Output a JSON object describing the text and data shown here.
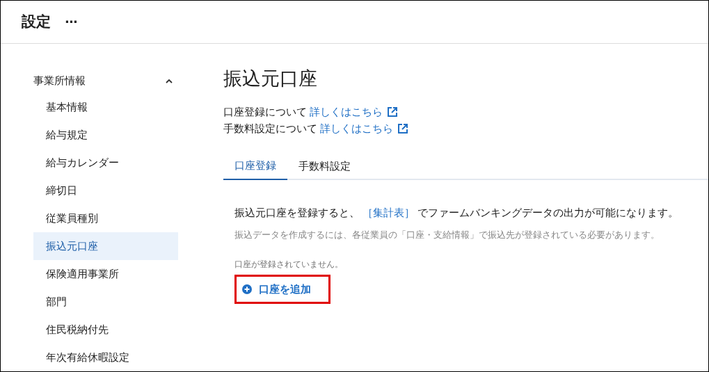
{
  "header": {
    "title": "設定",
    "more": "···"
  },
  "sidebar": {
    "group": {
      "label": "事業所情報",
      "expanded": true
    },
    "items": [
      {
        "label": "基本情報",
        "selected": false
      },
      {
        "label": "給与規定",
        "selected": false
      },
      {
        "label": "給与カレンダー",
        "selected": false
      },
      {
        "label": "締切日",
        "selected": false
      },
      {
        "label": "従業員種別",
        "selected": false
      },
      {
        "label": "振込元口座",
        "selected": true
      },
      {
        "label": "保険適用事業所",
        "selected": false
      },
      {
        "label": "部門",
        "selected": false
      },
      {
        "label": "住民税納付先",
        "selected": false
      },
      {
        "label": "年次有給休暇設定",
        "selected": false
      }
    ]
  },
  "main": {
    "title": "振込元口座",
    "help_links": [
      {
        "text": "口座登録について",
        "link": "詳しくはこちら"
      },
      {
        "text": "手数料設定について",
        "link": "詳しくはこちら"
      }
    ],
    "tabs": [
      {
        "label": "口座登録",
        "selected": true
      },
      {
        "label": "手数料設定",
        "selected": false
      }
    ],
    "description": {
      "before": "振込元口座を登録すると、",
      "link": "［集計表］",
      "after": "でファームバンキングデータの出力が可能になります。"
    },
    "note": "振込データを作成するには、各従業員の「口座・支給情報」で振込先が登録されている必要があります。",
    "empty_message": "口座が登録されていません。",
    "add_button": {
      "label": "口座を追加",
      "highlighted": true
    }
  }
}
